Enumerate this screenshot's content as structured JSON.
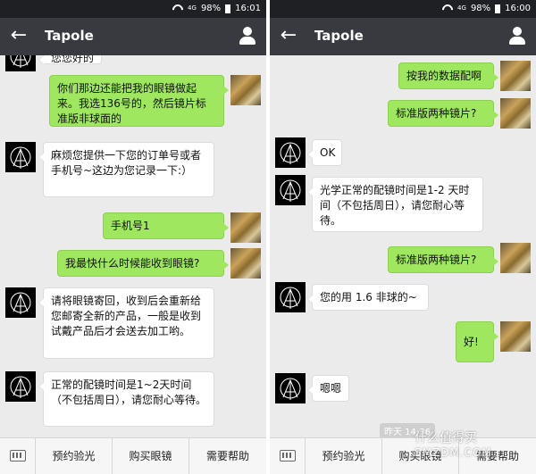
{
  "status_left": {
    "network": "4G",
    "battery": "98%",
    "time": "16:01"
  },
  "status_right": {
    "network": "4G",
    "battery": "98%",
    "time": "16:00"
  },
  "left": {
    "title": "Tapole",
    "partial_top": "您您好的",
    "messages": [
      {
        "from": "me",
        "text": "你们那边还能把我的眼镜做起来。我选136号的，然后镜片标准版非球面的"
      },
      {
        "from": "bot",
        "text": "麻烦您提供一下您的订单号或者手机号~这边为您记录一下:）"
      },
      {
        "from": "me",
        "text": "手机号1"
      },
      {
        "from": "me",
        "text": "我最快什么时候能收到眼镜?"
      },
      {
        "from": "bot",
        "text": "请将眼镜寄回，收到后会重新给您邮寄全新的产品，一般是收到试戴产品后才会送去加工哟。"
      },
      {
        "from": "bot",
        "text": "正常的配镜时间是1~2天时间（不包括周日），请您耐心等待。"
      }
    ],
    "bottom_menu": [
      "预约验光",
      "购买眼镜",
      "需要帮助"
    ]
  },
  "right": {
    "title": "Tapole",
    "messages": [
      {
        "from": "me",
        "text": "按我的数据配啊"
      },
      {
        "from": "me",
        "text": "标准版两种镜片?"
      },
      {
        "from": "bot",
        "text": "OK"
      },
      {
        "from": "bot",
        "text": "光学正常的配镜时间是1-2 天时间（不包括周日），请您耐心等待。"
      },
      {
        "from": "me",
        "text": "标准版两种镜片?"
      },
      {
        "from": "bot",
        "text": "您的用 1.6 非球的~"
      },
      {
        "from": "me",
        "text": "好!"
      },
      {
        "from": "bot",
        "text": "嗯嗯"
      }
    ],
    "timestamp": "昨天 14:36",
    "bottom_menu": [
      "预约验光",
      "购买眼镜",
      "需要帮助"
    ]
  },
  "watermark": {
    "line1": "什么值得买",
    "line2": "SMZDM.COM"
  },
  "colors": {
    "navbar": "#393a3f",
    "statusbar": "#1f2023",
    "chat_bg": "#ebebeb",
    "green_bubble": "#9fe75f"
  },
  "icons": {
    "back": "back-arrow-icon",
    "user": "user-profile-icon",
    "keyboard": "keyboard-icon"
  }
}
